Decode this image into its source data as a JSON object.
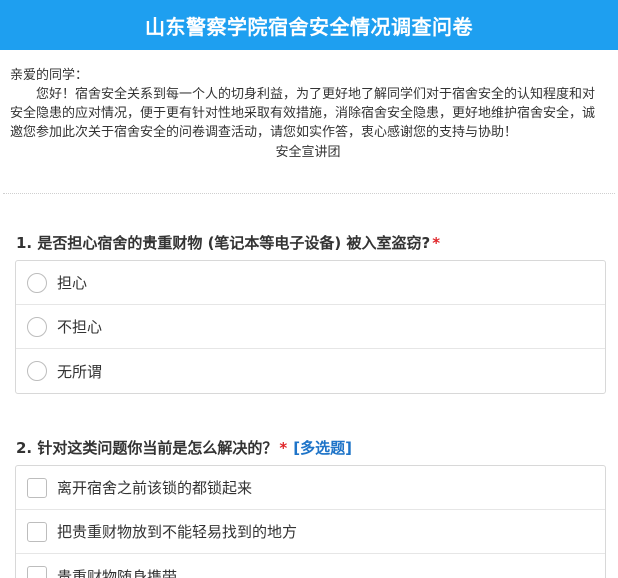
{
  "header": {
    "title": "山东警察学院宿舍安全情况调查问卷"
  },
  "intro": {
    "greeting": "亲爱的同学：",
    "body": "您好！宿舍安全关系到每一个人的切身利益，为了更好地了解同学们对于宿舍安全的认知程度和对安全隐患的应对情况，便于更有针对性地采取有效措施，消除宿舍安全隐患，更好地维护宿舍安全，诚邀您参加此次关于宿舍安全的问卷调查活动，请您如实作答，衷心感谢您的支持与协助！",
    "signature": "安全宣讲团"
  },
  "questions": [
    {
      "title": "1. 是否担心宿舍的贵重财物 (笔记本等电子设备) 被入室盗窃?",
      "required_mark": "*",
      "type": "radio",
      "options": [
        "担心",
        "不担心",
        "无所谓"
      ]
    },
    {
      "title": "2. 针对这类问题你当前是怎么解决的？",
      "required_mark": "*",
      "type_tag": "[多选题]",
      "type": "checkbox",
      "options": [
        "离开宿舍之前该锁的都锁起来",
        "把贵重财物放到不能轻易找到的地方",
        "贵重财物随身携带"
      ]
    }
  ],
  "colors": {
    "header_bg": "#1e9ff0",
    "required": "#e0262a",
    "multi_tag": "#1e74c8"
  }
}
